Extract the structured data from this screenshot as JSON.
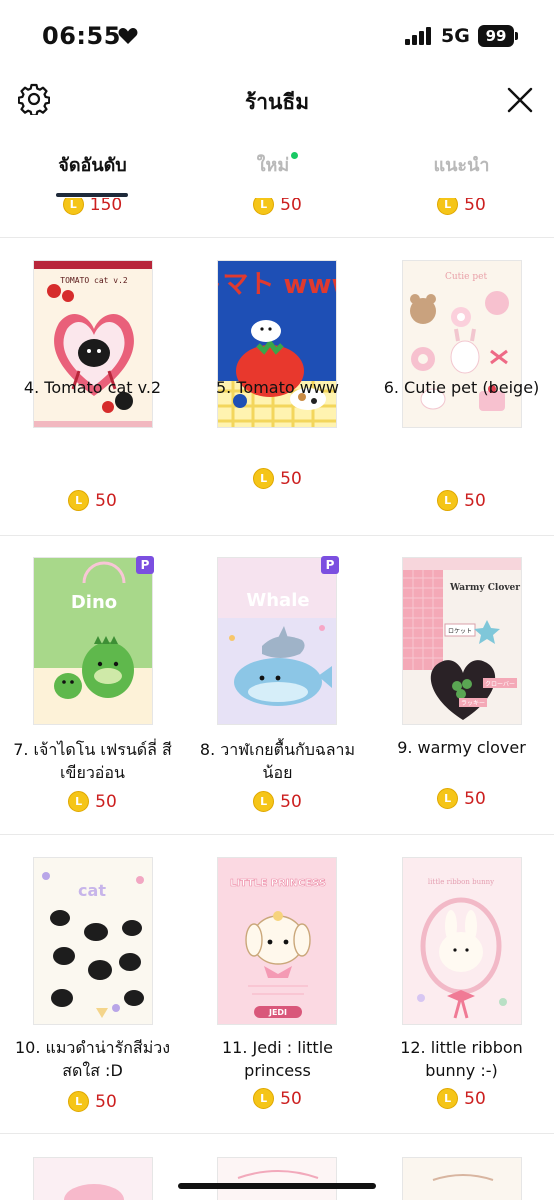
{
  "status_bar": {
    "time": "06:55",
    "network": "5G",
    "battery": "99"
  },
  "header": {
    "title": "ร้านธีม"
  },
  "tabs": [
    {
      "label": "จัดอันดับ",
      "active": true
    },
    {
      "label": "ใหม่",
      "active": false,
      "has_dot": true
    },
    {
      "label": "แนะนำ",
      "active": false
    }
  ],
  "coin_symbol": "L",
  "top_row_prices": [
    "150",
    "50",
    "50"
  ],
  "items": [
    {
      "name": "4. Tomato cat v.2",
      "price": "50",
      "premium": false
    },
    {
      "name": "5. Tomato www",
      "price": "50",
      "premium": false
    },
    {
      "name": "6. Cutie pet (beige)",
      "price": "50",
      "premium": false
    },
    {
      "name": "7. เจ้าไดโน เฟรนด์ลี่ สีเขียวอ่อน",
      "price": "50",
      "premium": true,
      "badge": "P"
    },
    {
      "name": "8. วาฬเกยตื้นกับฉลามน้อย",
      "price": "50",
      "premium": true,
      "badge": "P"
    },
    {
      "name": "9. warmy clover",
      "price": "50",
      "premium": false
    },
    {
      "name": "10. แมวดำน่ารักสีม่วงสดใส :D",
      "price": "50",
      "premium": false
    },
    {
      "name": "11. Jedi : little princess",
      "price": "50",
      "premium": false
    },
    {
      "name": "12. little ribbon bunny :-)",
      "price": "50",
      "premium": false
    }
  ],
  "thumbnail_texts": {
    "t4": "TOMATO cat v.2",
    "t5": "トマト www",
    "t6": "Cutie pet",
    "t7": "Dino",
    "t8": "Whale",
    "t9_a": "Warmy Clover",
    "t9_b": "ロケット",
    "t9_c": "クローバー",
    "t9_d": "ラッキー",
    "t10": "cat",
    "t11_a": "LITTLE PRINCESS",
    "t11_b": "JEDI",
    "t12": "little ribbon bunny"
  },
  "colors": {
    "price": "#cc1f1f",
    "coin": "#f5c518",
    "premium_badge": "#7b4fe0",
    "new_dot": "#18c964",
    "tab_indicator": "#1e2a3a"
  }
}
